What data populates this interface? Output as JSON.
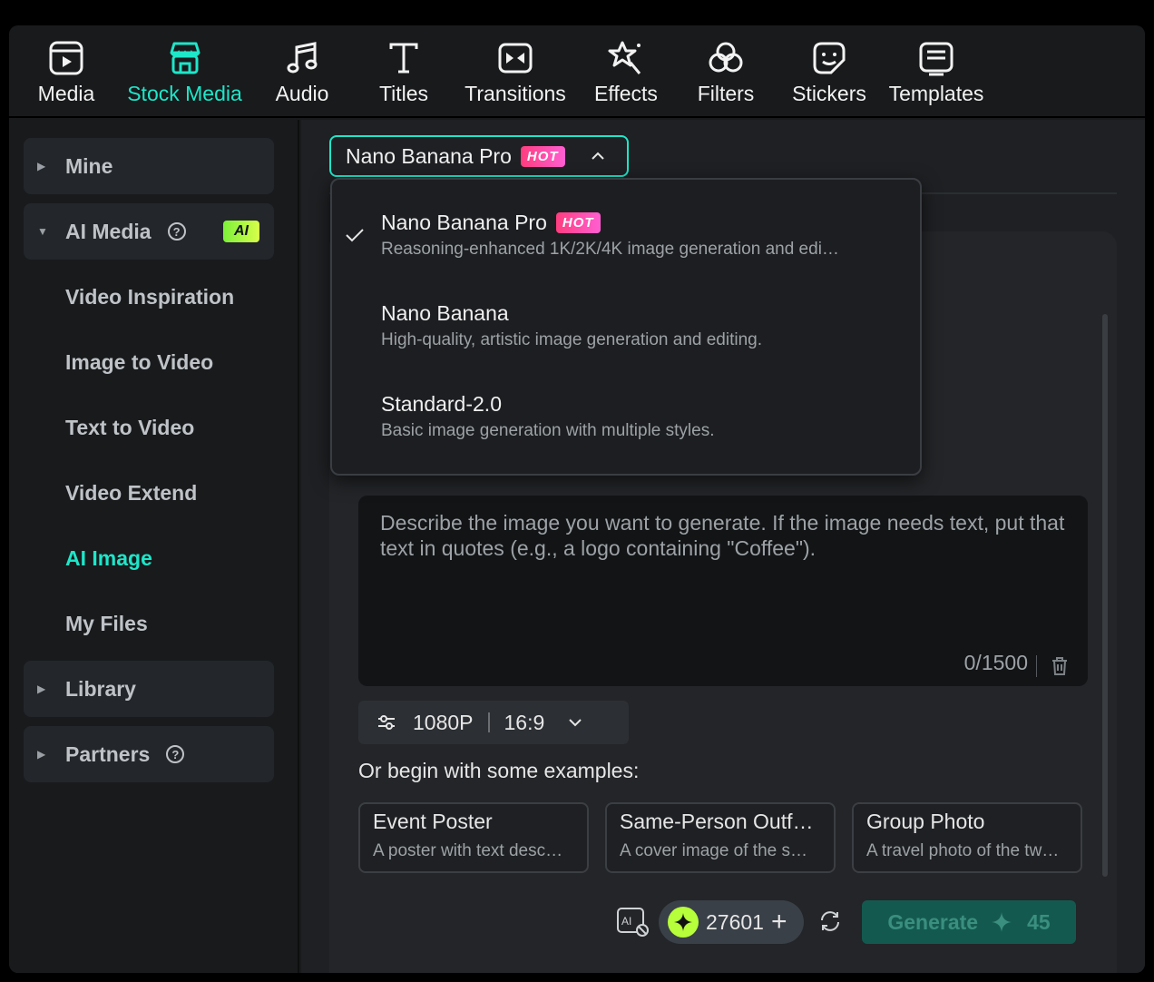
{
  "toolbar": {
    "tabs": [
      {
        "label": "Media",
        "icon": "media-icon"
      },
      {
        "label": "Stock Media",
        "icon": "store-icon"
      },
      {
        "label": "Audio",
        "icon": "music-note-icon"
      },
      {
        "label": "Titles",
        "icon": "text-t-icon"
      },
      {
        "label": "Transitions",
        "icon": "transition-icon"
      },
      {
        "label": "Effects",
        "icon": "star-wand-icon"
      },
      {
        "label": "Filters",
        "icon": "filter-circles-icon"
      },
      {
        "label": "Stickers",
        "icon": "sticker-icon"
      },
      {
        "label": "Templates",
        "icon": "template-icon"
      }
    ],
    "active_tab": "Stock Media"
  },
  "sidebar": {
    "mine": "Mine",
    "ai_media": "AI Media",
    "ai_badge": "AI",
    "items": [
      "Video Inspiration",
      "Image to Video",
      "Text to Video",
      "Video Extend",
      "AI Image",
      "My Files"
    ],
    "active_item": "AI Image",
    "library": "Library",
    "partners": "Partners"
  },
  "model_select": {
    "selected": "Nano Banana Pro",
    "badge": "HOT"
  },
  "dropdown": {
    "options": [
      {
        "name": "Nano Banana Pro",
        "badge": "HOT",
        "desc": "Reasoning-enhanced 1K/2K/4K image generation and edi…",
        "selected": true
      },
      {
        "name": "Nano Banana",
        "desc": "High-quality, artistic image generation and editing.",
        "selected": false
      },
      {
        "name": "Standard-2.0",
        "desc": "Basic image generation with multiple styles.",
        "selected": false
      }
    ]
  },
  "prompt": {
    "placeholder": "Describe the image you want to generate. If the image needs text, put that text in quotes (e.g., a logo containing \"Coffee\").",
    "count": "0/1500"
  },
  "settings": {
    "resolution": "1080P",
    "ratio": "16:9"
  },
  "examples": {
    "title": "Or begin with some examples:",
    "cards": [
      {
        "title": "Event Poster",
        "desc": "A poster with text desc…"
      },
      {
        "title": "Same-Person Outf…",
        "desc": "A cover image of the s…"
      },
      {
        "title": "Group Photo",
        "desc": "A travel photo of the tw…"
      }
    ]
  },
  "footer": {
    "credits": "27601",
    "generate_label": "Generate",
    "generate_cost": "45"
  },
  "colors": {
    "accent": "#1ee6c9",
    "hot_badge": "#ff4fa8",
    "ai_badge": "#b6ff3a",
    "generate_bg": "#14594f"
  }
}
